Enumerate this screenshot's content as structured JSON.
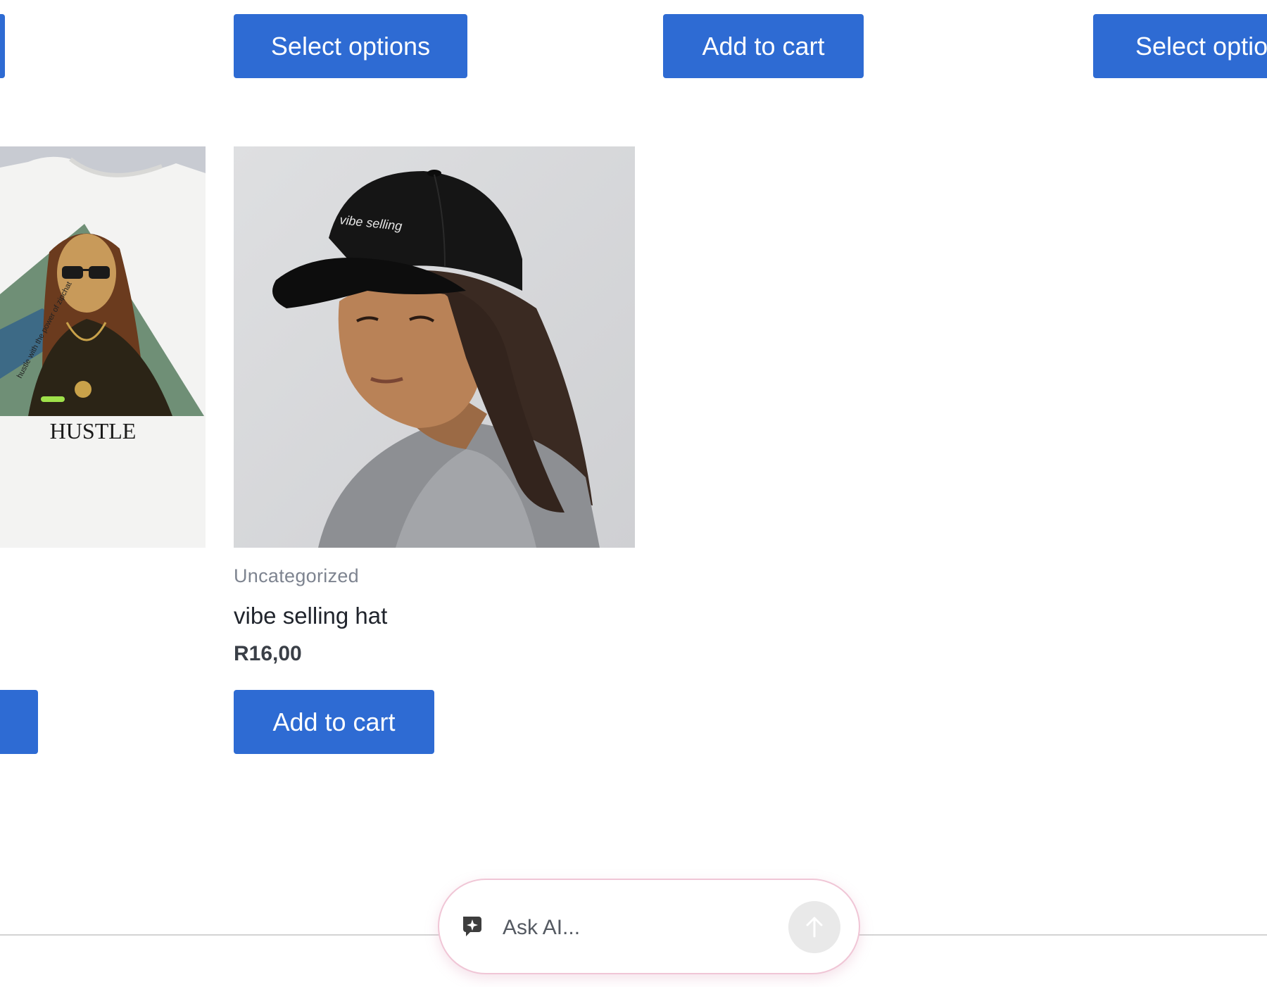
{
  "top_row": {
    "select_options_1": "Select options",
    "add_to_cart_1": "Add to cart",
    "select_options_2": "Select options"
  },
  "tshirt": {
    "print_text": "HUSTLE"
  },
  "product": {
    "category": "Uncategorized",
    "title": "vibe selling hat",
    "price": "R16,00",
    "add_to_cart": "Add to cart",
    "hat_text": "vibe selling"
  },
  "ask_ai": {
    "placeholder": "Ask AI..."
  },
  "colors": {
    "button": "#2e6bd3",
    "category_text": "#7e8490",
    "ask_border": "#f0c6d6"
  }
}
